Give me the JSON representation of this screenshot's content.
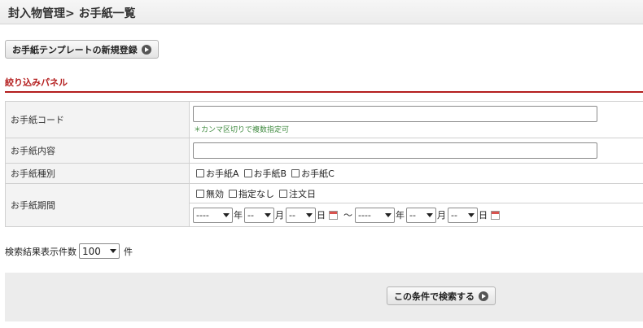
{
  "header": {
    "title": "封入物管理> お手紙一覧"
  },
  "toolbar": {
    "new_template_label": "お手紙テンプレートの新規登録"
  },
  "panel": {
    "title": "絞り込みパネル"
  },
  "filters": {
    "code": {
      "label": "お手紙コード",
      "value": "",
      "hint": "＊カンマ区切りで複数指定可"
    },
    "content": {
      "label": "お手紙内容",
      "value": ""
    },
    "type": {
      "label": "お手紙種別",
      "options": [
        {
          "label": "お手紙A",
          "checked": false
        },
        {
          "label": "お手紙B",
          "checked": false
        },
        {
          "label": "お手紙C",
          "checked": false
        }
      ]
    },
    "period": {
      "label": "お手紙期間",
      "options": [
        {
          "label": "無効",
          "checked": false
        },
        {
          "label": "指定なし",
          "checked": false
        },
        {
          "label": "注文日",
          "checked": false
        }
      ],
      "from": {
        "year": "----",
        "month": "--",
        "day": "--"
      },
      "to": {
        "year": "----",
        "month": "--",
        "day": "--"
      },
      "unit_year": "年",
      "unit_month": "月",
      "unit_day": "日",
      "separator": "～"
    }
  },
  "result_count": {
    "label": "検索結果表示件数",
    "value": "100",
    "unit": "件"
  },
  "search_button": {
    "label": "この条件で検索する"
  }
}
